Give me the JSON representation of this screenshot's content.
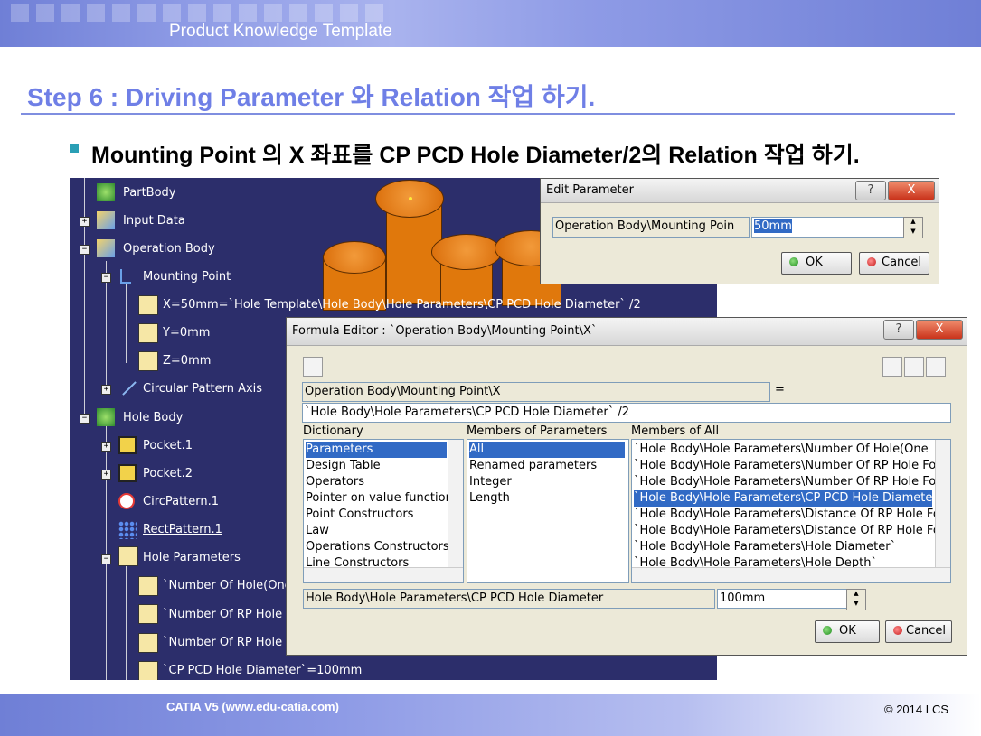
{
  "header": {
    "title": "Product Knowledge Template"
  },
  "slide": {
    "step_title": "Step 6 : Driving Parameter 와 Relation 작업 하기.",
    "subtitle": "Mounting Point 의 X 좌표를 CP PCD Hole Diameter/2의 Relation 작업 하기."
  },
  "tree": {
    "nodes": [
      "PartBody",
      "Input Data",
      "Operation Body",
      "Mounting Point",
      "X=50mm=`Hole Template\\Hole Body\\Hole Parameters\\CP PCD Hole Diameter` /2",
      "Y=0mm",
      "Z=0mm",
      "Circular Pattern Axis",
      "Hole Body",
      "Pocket.1",
      "Pocket.2",
      "CircPattern.1",
      "RectPattern.1",
      "Hole Parameters",
      "`Number Of Hole(One",
      "`Number Of RP Hole F",
      "`Number Of RP Hole F",
      "`CP PCD Hole Diameter`=100mm"
    ]
  },
  "edit_parameter": {
    "title": "Edit Parameter",
    "label_field": "Operation Body\\Mounting Poin",
    "value": "50mm",
    "ok": "OK",
    "cancel": "Cancel",
    "help": "?",
    "close": "X"
  },
  "formula_editor": {
    "title": "Formula Editor : `Operation Body\\Mounting Point\\X`",
    "help": "?",
    "close": "X",
    "target": "Operation Body\\Mounting Point\\X",
    "equals": "=",
    "formula": "`Hole Body\\Hole Parameters\\CP PCD Hole Diameter` /2",
    "dictionary_header": "Dictionary",
    "members_params_header": "Members of Parameters",
    "members_all_header": "Members of All",
    "dictionary": [
      "Parameters",
      "Design Table",
      "Operators",
      "Pointer on value function",
      "Point Constructors",
      "Law",
      "Operations Constructors",
      "Line Constructors"
    ],
    "members_params": [
      "All",
      "Renamed parameters",
      "Integer",
      "Length"
    ],
    "members_all": [
      "`Hole Body\\Hole Parameters\\Number Of Hole(One ",
      "`Hole Body\\Hole Parameters\\Number Of RP Hole Fo",
      "`Hole Body\\Hole Parameters\\Number Of RP Hole Fo",
      "`Hole Body\\Hole Parameters\\CP PCD Hole Diamete",
      "`Hole Body\\Hole Parameters\\Distance Of RP Hole Fo",
      "`Hole Body\\Hole Parameters\\Distance Of RP Hole Fo",
      "`Hole Body\\Hole Parameters\\Hole Diameter`",
      "`Hole Body\\Hole Parameters\\Hole Depth`"
    ],
    "selected_param": "Hole Body\\Hole Parameters\\CP PCD Hole Diameter",
    "selected_value": "100mm",
    "ok": "OK",
    "cancel": "Cancel"
  },
  "footer": {
    "left": "CATIA V5 (www.edu-catia.com)",
    "right": "© 2014 LCS"
  },
  "colors": {
    "accent": "#6f7fe6",
    "tree_bg": "#2c2e6b",
    "part": "#e0780c",
    "selection": "#316ac5"
  }
}
